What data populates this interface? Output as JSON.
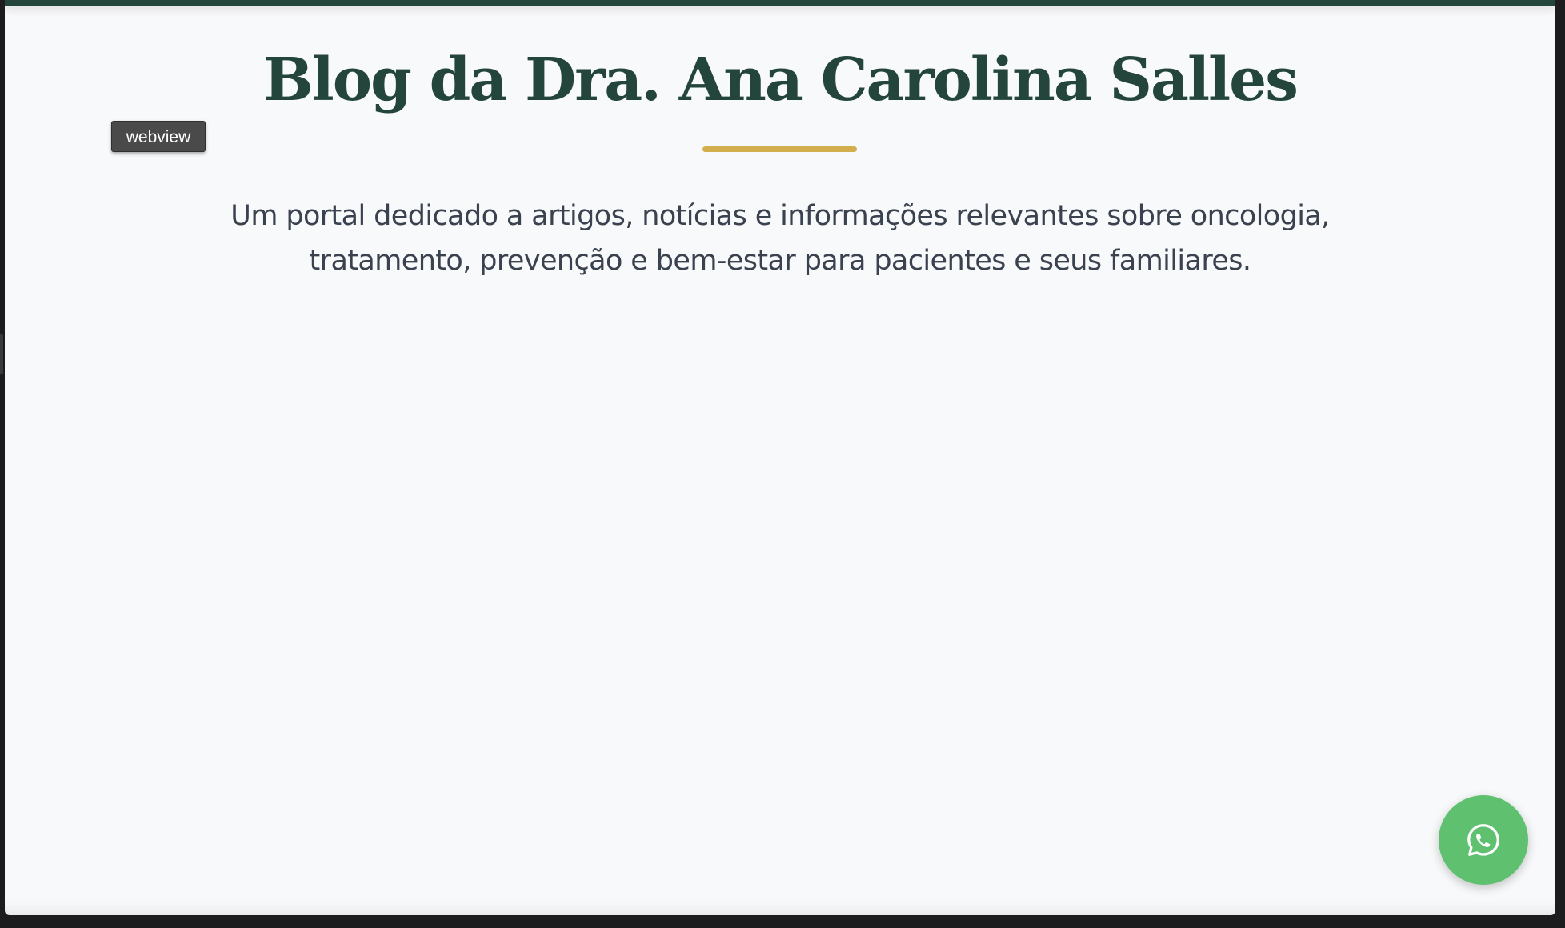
{
  "page": {
    "title": "Blog da Dra. Ana Carolina Salles",
    "subtitle_line1": "Um portal dedicado a artigos, notícias e informações relevantes sobre oncologia,",
    "subtitle_line2": "tratamento, prevenção e bem-estar para pacientes e seus familiares."
  },
  "overlay": {
    "webview_label": "webview"
  },
  "floating_action": {
    "icon": "whatsapp-icon"
  },
  "colors": {
    "brand_dark_green": "#24453b",
    "accent_gold": "#d3ae4c",
    "page_background": "#f8f9fa",
    "body_text": "#3a4250",
    "whatsapp_green": "#5fc16f"
  }
}
